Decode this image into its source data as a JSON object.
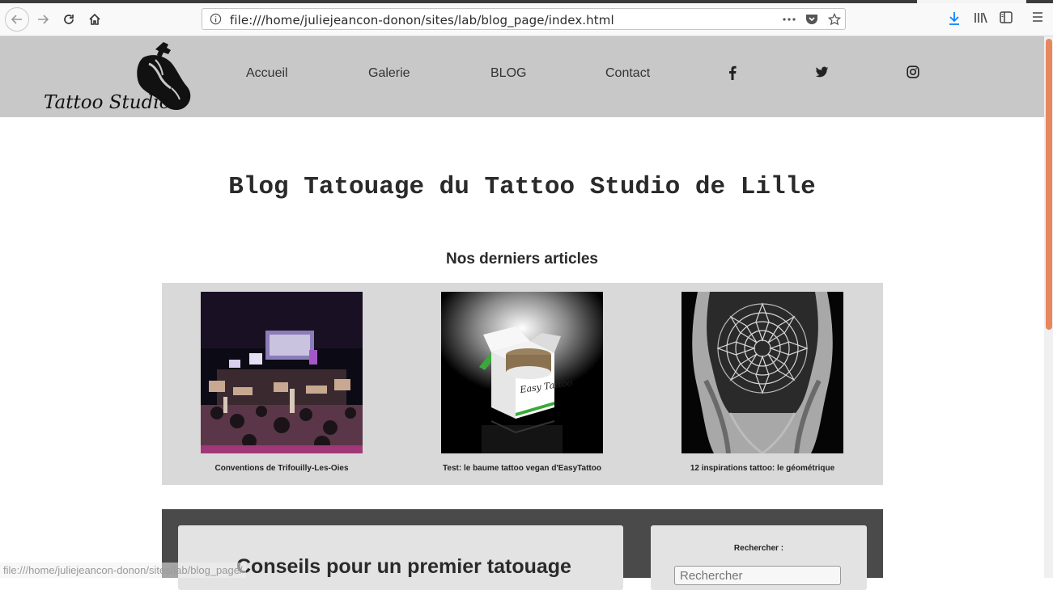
{
  "browser": {
    "url": "file:///home/juliejeancon-donon/sites/lab/blog_page/index.html",
    "status_url": "file:///home/juliejeancon-donon/sites/lab/blog_page/"
  },
  "nav": {
    "logo_text": "Tattoo Studio",
    "links": [
      {
        "label": "Accueil"
      },
      {
        "label": "Galerie"
      },
      {
        "label": "BLOG"
      },
      {
        "label": "Contact"
      }
    ],
    "social": [
      "facebook-icon",
      "twitter-icon",
      "instagram-icon"
    ]
  },
  "main": {
    "title": "Blog Tatouage du Tattoo Studio de Lille",
    "latest_heading": "Nos derniers articles",
    "articles": [
      {
        "caption": "Conventions de Trifouilly-Les-Oies"
      },
      {
        "caption": "Test: le baume tattoo vegan d'EasyTattoo"
      },
      {
        "caption": "12 inspirations tattoo: le géométrique"
      }
    ],
    "post_title": "Conseils pour un premier tatouage",
    "search": {
      "label": "Rechercher :",
      "placeholder": "Rechercher"
    },
    "product_label": "Easy Tattoo"
  },
  "colors": {
    "nav_bg": "#c8c8c8",
    "articles_bg": "#d9d9d9",
    "dark_block": "#4a4a4a",
    "scroll_accent": "#e8875f"
  }
}
